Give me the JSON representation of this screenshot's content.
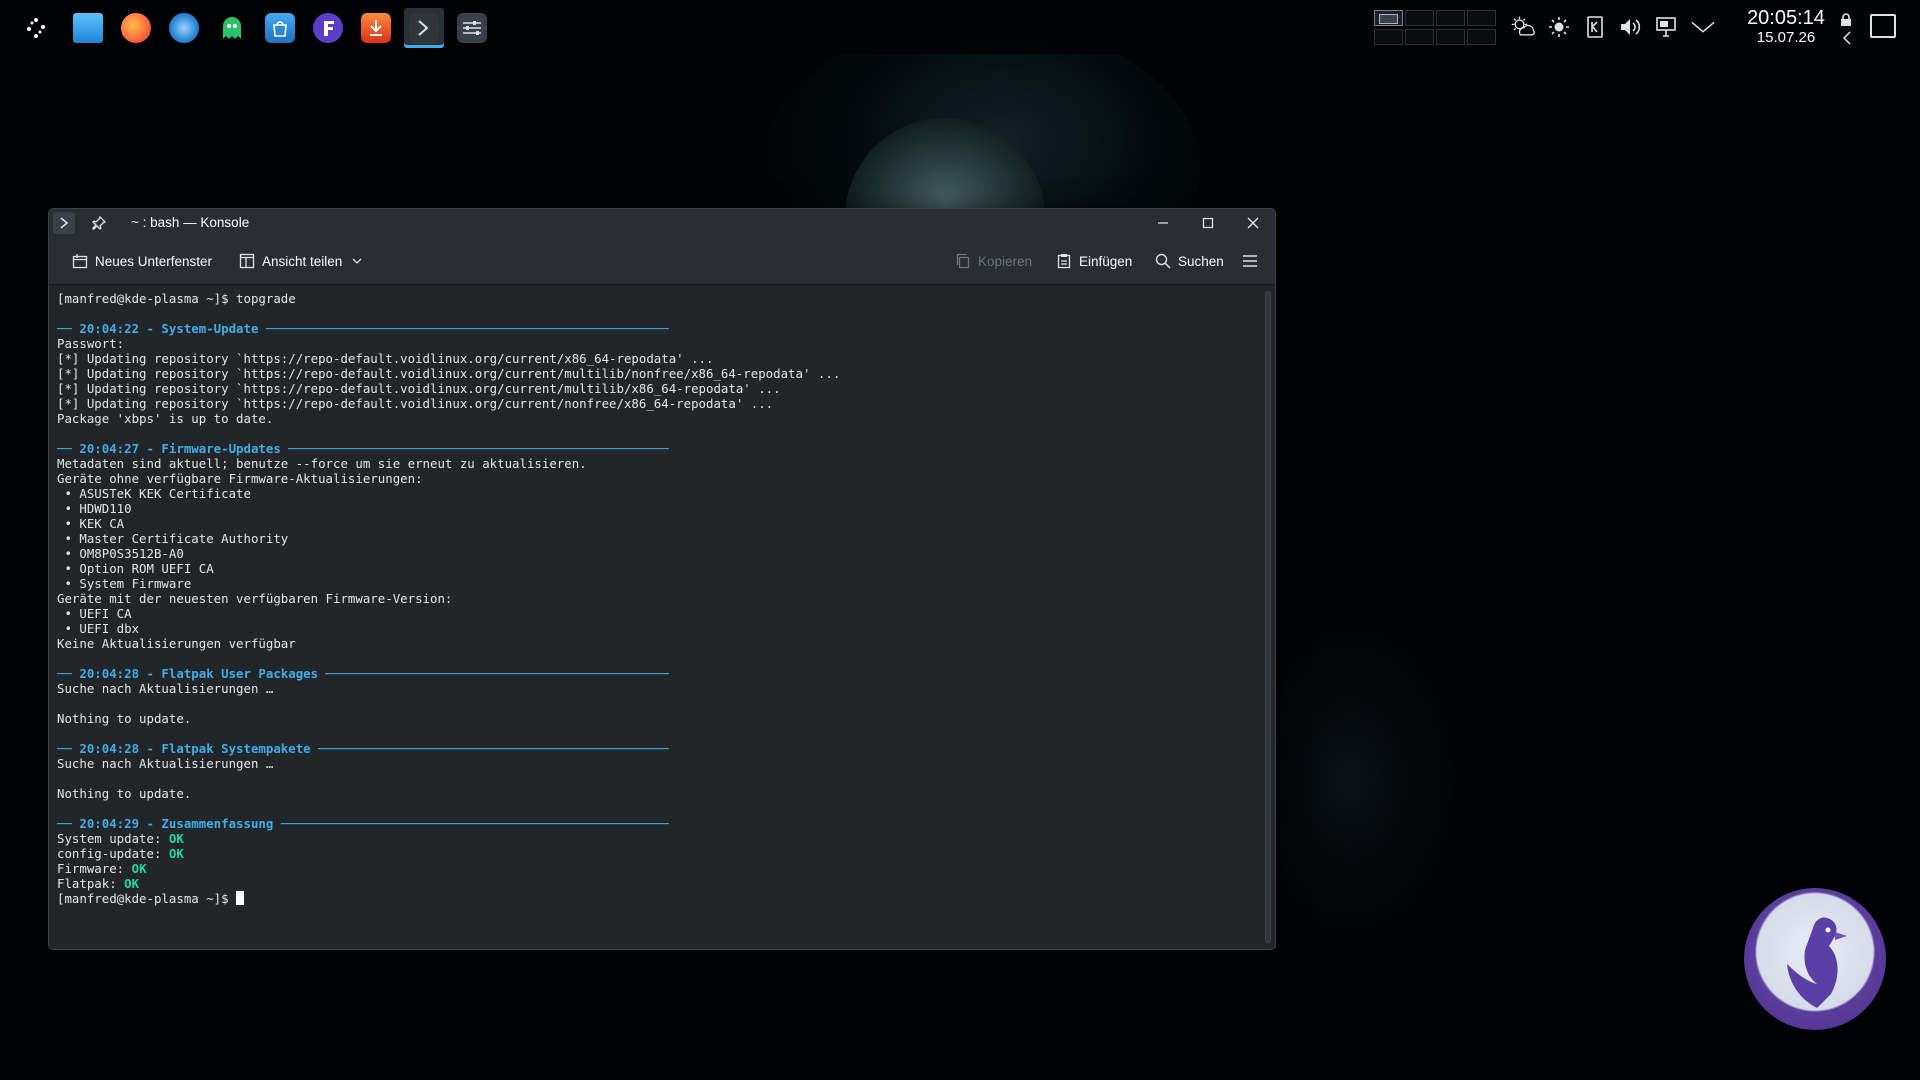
{
  "panel": {
    "launcher_icon": "application-launcher-icon",
    "tasks": [
      {
        "name": "file-manager-icon",
        "color": "#1d99f3",
        "active": false
      },
      {
        "name": "firefox-icon",
        "color": "#ff7139",
        "active": false
      },
      {
        "name": "thunderbird-icon",
        "color": "#2a86d4",
        "active": false
      },
      {
        "name": "ghost-app-icon",
        "color": "#27c26a",
        "active": false
      },
      {
        "name": "software-store-icon",
        "color": "#2f8fd9",
        "active": false
      },
      {
        "name": "filezilla-icon",
        "color": "#5a3ec8",
        "active": false
      },
      {
        "name": "video-downloader-icon",
        "color": "#e8531f",
        "active": false
      },
      {
        "name": "konsole-icon",
        "color": "#31363b",
        "active": true
      },
      {
        "name": "settings-mixer-icon",
        "color": "#3b4148",
        "active": false
      }
    ],
    "clock": {
      "time": "20:05:14",
      "date": "15.07.26"
    }
  },
  "window": {
    "title": "~ : bash — Konsole",
    "toolbar": {
      "new_tab": "Neues Unterfenster",
      "split_view": "Ansicht teilen",
      "copy": "Kopieren",
      "paste": "Einfügen",
      "search": "Suchen"
    }
  },
  "terminal": {
    "lines": [
      [
        {
          "t": "[manfred@kde-plasma ~]$ topgrade",
          "c": ""
        }
      ],
      [
        {
          "t": "",
          "c": ""
        }
      ],
      [
        {
          "t": "── 20:04:22 - System-Update ──────────────────────────────────────────────────────",
          "c": "sep"
        }
      ],
      [
        {
          "t": "Passwort:",
          "c": ""
        }
      ],
      [
        {
          "t": "[*] Updating repository `https://repo-default.voidlinux.org/current/x86_64-repodata' ...",
          "c": ""
        }
      ],
      [
        {
          "t": "[*] Updating repository `https://repo-default.voidlinux.org/current/multilib/nonfree/x86_64-repodata' ...",
          "c": ""
        }
      ],
      [
        {
          "t": "[*] Updating repository `https://repo-default.voidlinux.org/current/multilib/x86_64-repodata' ...",
          "c": ""
        }
      ],
      [
        {
          "t": "[*] Updating repository `https://repo-default.voidlinux.org/current/nonfree/x86_64-repodata' ...",
          "c": ""
        }
      ],
      [
        {
          "t": "Package 'xbps' is up to date.",
          "c": ""
        }
      ],
      [
        {
          "t": "",
          "c": ""
        }
      ],
      [
        {
          "t": "── 20:04:27 - Firmware-Updates ───────────────────────────────────────────────────",
          "c": "sep"
        }
      ],
      [
        {
          "t": "Metadaten sind aktuell; benutze --force um sie erneut zu aktualisieren.",
          "c": ""
        }
      ],
      [
        {
          "t": "Geräte ohne verfügbare Firmware-Aktualisierungen:",
          "c": ""
        }
      ],
      [
        {
          "t": " • ASUSTeK KEK Certificate",
          "c": ""
        }
      ],
      [
        {
          "t": " • HDWD110",
          "c": ""
        }
      ],
      [
        {
          "t": " • KEK CA",
          "c": ""
        }
      ],
      [
        {
          "t": " • Master Certificate Authority",
          "c": ""
        }
      ],
      [
        {
          "t": " • OM8P0S3512B-A0",
          "c": ""
        }
      ],
      [
        {
          "t": " • Option ROM UEFI CA",
          "c": ""
        }
      ],
      [
        {
          "t": " • System Firmware",
          "c": ""
        }
      ],
      [
        {
          "t": "Geräte mit der neuesten verfügbaren Firmware-Version:",
          "c": ""
        }
      ],
      [
        {
          "t": " • UEFI CA",
          "c": ""
        }
      ],
      [
        {
          "t": " • UEFI dbx",
          "c": ""
        }
      ],
      [
        {
          "t": "Keine Aktualisierungen verfügbar",
          "c": ""
        }
      ],
      [
        {
          "t": "",
          "c": ""
        }
      ],
      [
        {
          "t": "── 20:04:28 - Flatpak User Packages ──────────────────────────────────────────────",
          "c": "sep"
        }
      ],
      [
        {
          "t": "Suche nach Aktualisierungen …",
          "c": ""
        }
      ],
      [
        {
          "t": "",
          "c": ""
        }
      ],
      [
        {
          "t": "Nothing to update.",
          "c": ""
        }
      ],
      [
        {
          "t": "",
          "c": ""
        }
      ],
      [
        {
          "t": "── 20:04:28 - Flatpak Systempakete ───────────────────────────────────────────────",
          "c": "sep"
        }
      ],
      [
        {
          "t": "Suche nach Aktualisierungen …",
          "c": ""
        }
      ],
      [
        {
          "t": "",
          "c": ""
        }
      ],
      [
        {
          "t": "Nothing to update.",
          "c": ""
        }
      ],
      [
        {
          "t": "",
          "c": ""
        }
      ],
      [
        {
          "t": "── 20:04:29 - Zusammenfassung ────────────────────────────────────────────────────",
          "c": "sep"
        }
      ],
      [
        {
          "t": "System update: ",
          "c": ""
        },
        {
          "t": "OK",
          "c": "ok"
        }
      ],
      [
        {
          "t": "config-update: ",
          "c": ""
        },
        {
          "t": "OK",
          "c": "ok"
        }
      ],
      [
        {
          "t": "Firmware: ",
          "c": ""
        },
        {
          "t": "OK",
          "c": "ok"
        }
      ],
      [
        {
          "t": "Flatpak: ",
          "c": ""
        },
        {
          "t": "OK",
          "c": "ok"
        }
      ],
      [
        {
          "t": "[manfred@kde-plasma ~]$ ",
          "c": ""
        },
        {
          "t": "",
          "c": "cursor"
        }
      ]
    ]
  },
  "colors": {
    "accent": "#3daee9",
    "ok": "#1cdc9a",
    "terminal_bg": "#232629",
    "desktop_bg": "#010203"
  }
}
